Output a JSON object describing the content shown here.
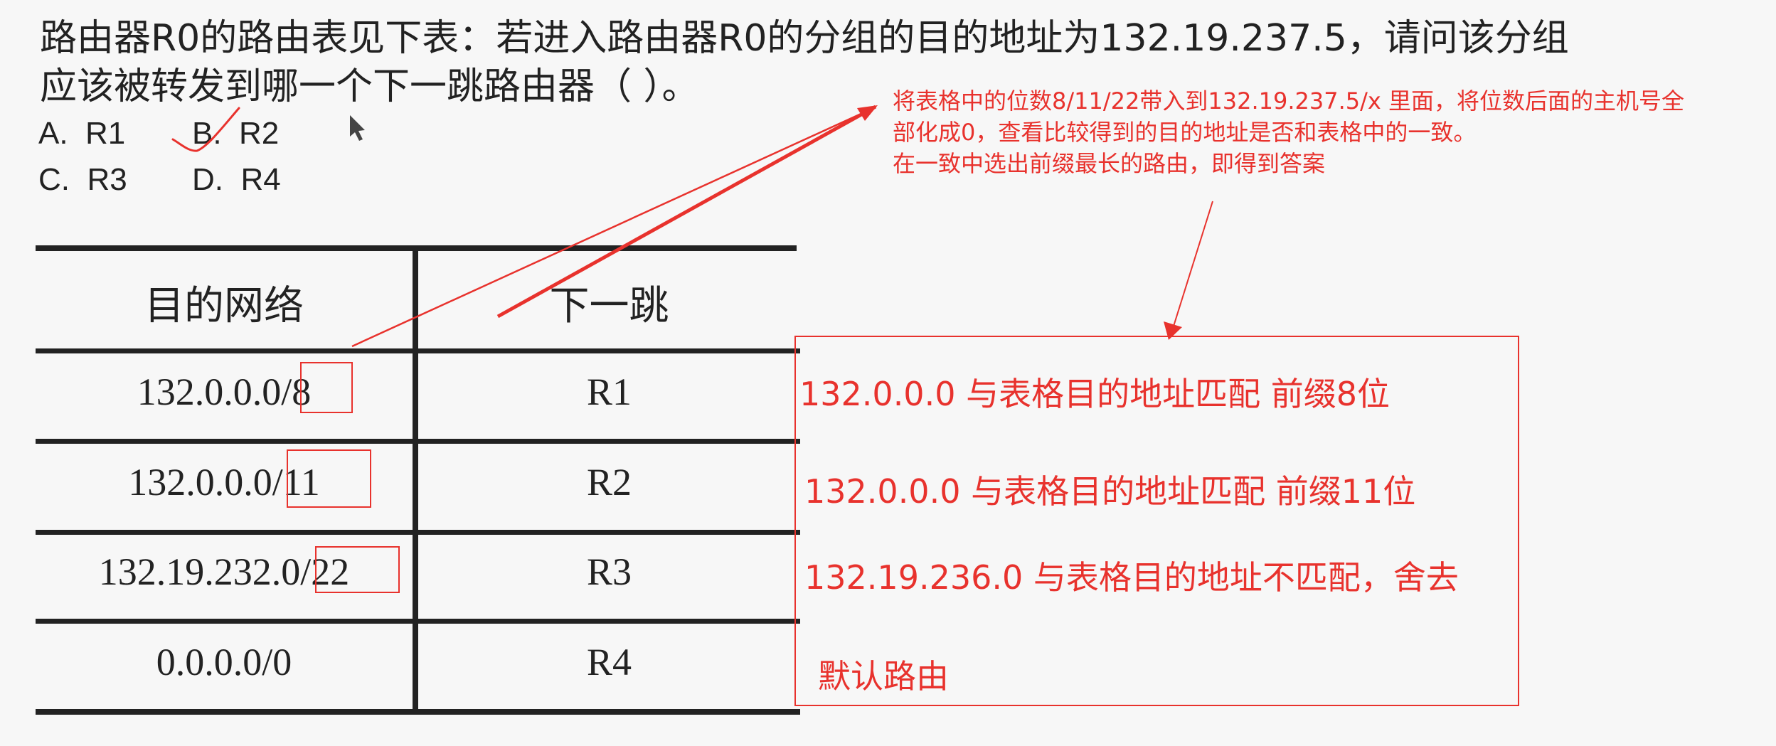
{
  "question": {
    "line1": "路由器R0的路由表见下表：若进入路由器R0的分组的目的地址为132.19.237.5，请问该分组",
    "line2": "应该被转发到哪一个下一跳路由器（        ）。"
  },
  "options": [
    {
      "letter": "A.",
      "value": "R1"
    },
    {
      "letter": "B.",
      "value": "R2"
    },
    {
      "letter": "C.",
      "value": "R3"
    },
    {
      "letter": "D.",
      "value": "R4"
    }
  ],
  "table": {
    "headers": [
      "目的网络",
      "下一跳"
    ],
    "rows": [
      {
        "net": "132.0.0.0",
        "prefix": "/8",
        "hop": "R1"
      },
      {
        "net": "132.0.0.0",
        "prefix": "/11",
        "hop": "R2"
      },
      {
        "net": "132.19.232.0",
        "prefix": "/22",
        "hop": "R3"
      },
      {
        "net": "0.0.0.0/0",
        "prefix": "",
        "hop": "R4"
      }
    ]
  },
  "annotation": {
    "line1": "将表格中的位数8/11/22带入到132.19.237.5/x 里面，将位数后面的主机号全",
    "line2": "部化成0，查看比较得到的目的地址是否和表格中的一致。",
    "line3": "在一致中选出前缀最长的路由，即得到答案"
  },
  "answers": [
    "132.0.0.0 与表格目的地址匹配 前缀8位",
    "132.0.0.0 与表格目的地址匹配 前缀11位",
    "132.19.236.0 与表格目的地址不匹配，舍去",
    "默认路由"
  ],
  "colors": {
    "accent": "#e8322d",
    "text": "#222222",
    "background": "#f7f7f7"
  }
}
